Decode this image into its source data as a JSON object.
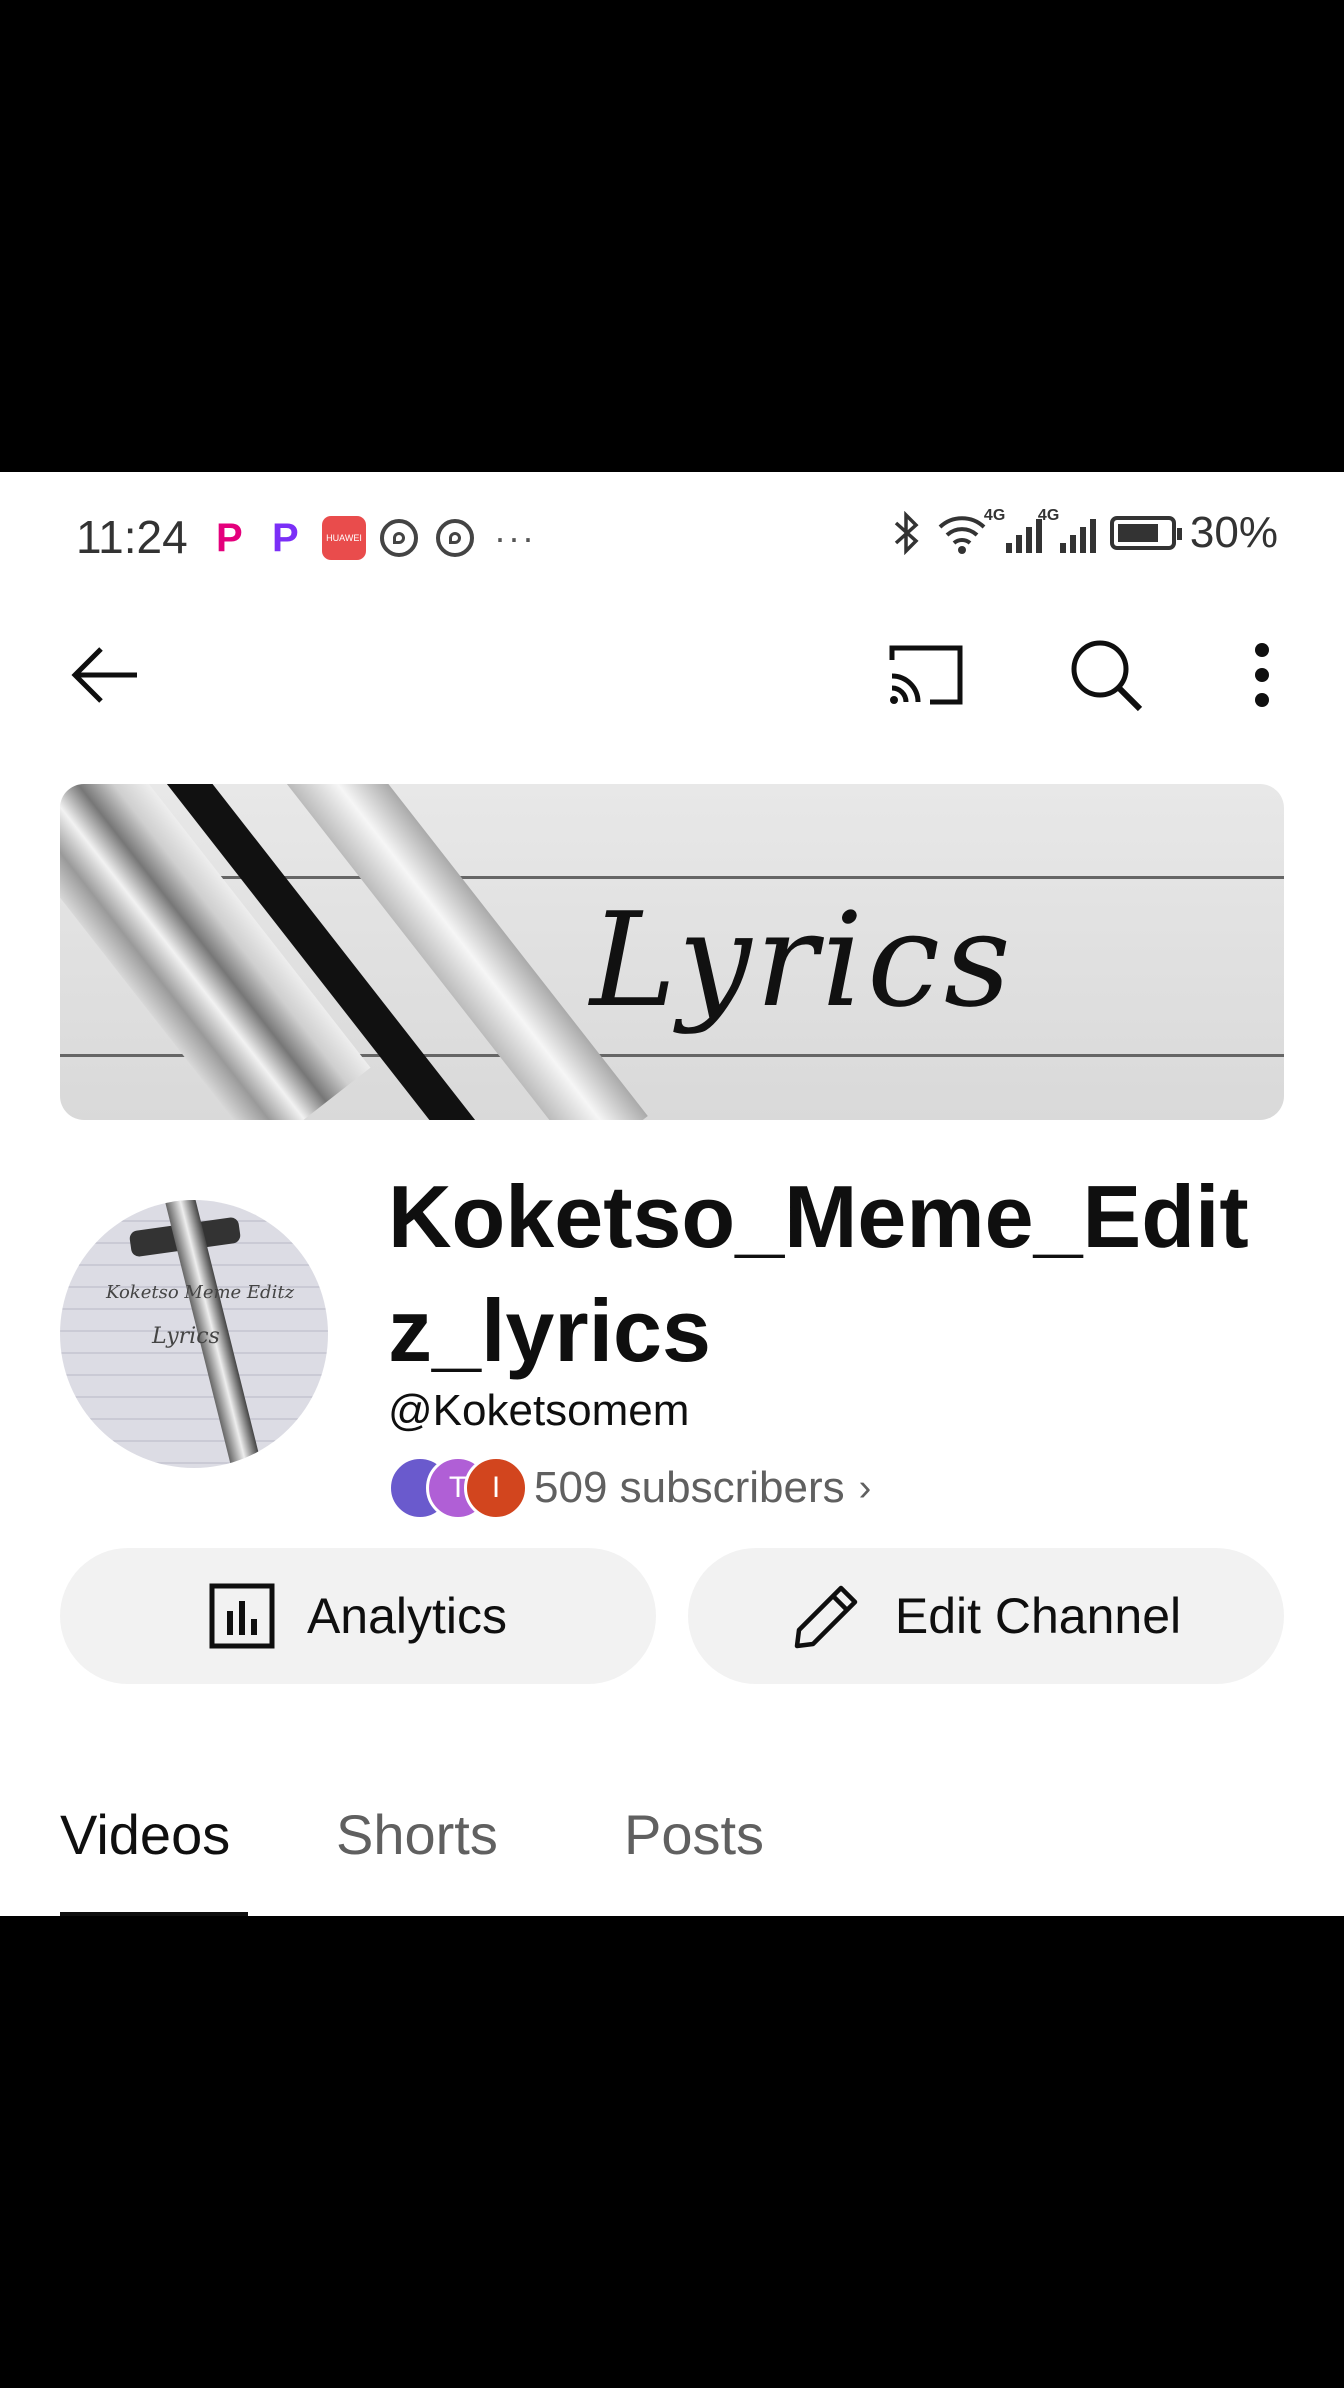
{
  "status_bar": {
    "time": "11:24",
    "hw_label": "HUAWEI",
    "more": "···",
    "net_tag": "4G",
    "battery": "30%"
  },
  "banner": {
    "text": "Lyrics"
  },
  "avatar": {
    "scribble": "Koketso Meme Editz",
    "scribble2": "Lyrics"
  },
  "channel": {
    "name": "Koketso_Meme_Editz_lyrics",
    "handle": "@Koketsomem",
    "subscribers": "509 subscribers",
    "faces": [
      "T",
      "I"
    ]
  },
  "actions": {
    "analytics": "Analytics",
    "edit": "Edit Channel"
  },
  "tabs": [
    "Videos",
    "Shorts",
    "Posts"
  ],
  "colors": {
    "face1": "#6a5acd",
    "face2": "#b05fd6",
    "face3": "#d2451e"
  }
}
